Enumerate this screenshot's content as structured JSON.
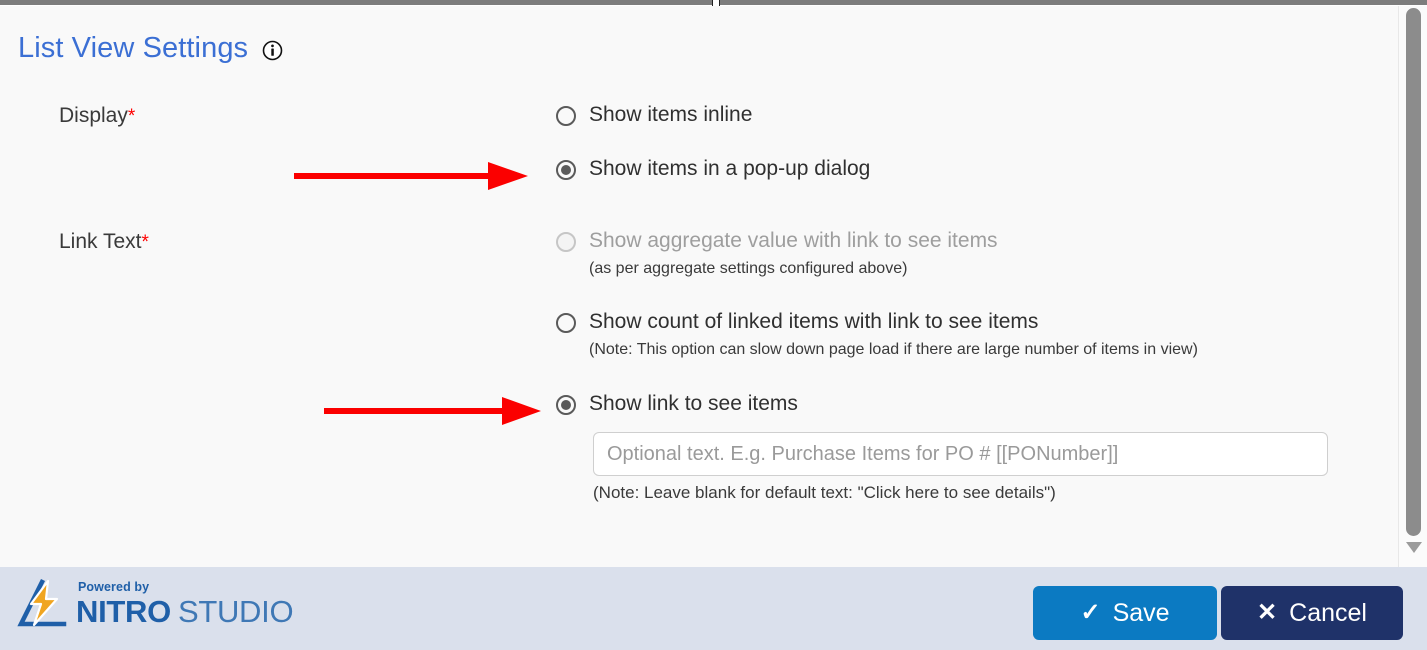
{
  "window": {
    "title": "List View Settings",
    "info_icon": "info-circle-icon"
  },
  "form": {
    "fields": [
      {
        "label": "Display",
        "required_marker": "*"
      },
      {
        "label": "Link Text",
        "required_marker": "*"
      }
    ],
    "display_options": [
      {
        "label": "Show items inline",
        "selected": false,
        "disabled": false,
        "note": ""
      },
      {
        "label": "Show items in a pop-up dialog",
        "selected": true,
        "disabled": false,
        "note": ""
      }
    ],
    "link_text_options": [
      {
        "label": "Show aggregate value with link to see items",
        "selected": false,
        "disabled": true,
        "note": "(as per aggregate settings configured above)"
      },
      {
        "label": "Show count of linked items with link to see items",
        "selected": false,
        "disabled": false,
        "note": "(Note: This option can slow down page load if there are large number of items in view)"
      },
      {
        "label": "Show link to see items",
        "selected": true,
        "disabled": false,
        "note": ""
      }
    ],
    "link_text_input": {
      "value": "",
      "placeholder": "Optional text. E.g. Purchase Items for PO # [[PONumber]]",
      "note": "(Note: Leave blank for default text: \"Click here to see details\")"
    }
  },
  "annotations": {
    "arrow_color": "#fb0000",
    "arrows": [
      {
        "name": "arrow-to-popup-option"
      },
      {
        "name": "arrow-to-show-link-option"
      }
    ]
  },
  "footer": {
    "logo": {
      "powered_by": "Powered by",
      "brand_primary": "NITRO",
      "brand_secondary": "STUDIO",
      "mark": "nitro-lightning-triangle-logo"
    },
    "save_label": "Save",
    "save_icon": "check-icon",
    "cancel_label": "Cancel",
    "cancel_icon": "close-x-icon",
    "save_color": "#0b7ac2",
    "cancel_color": "#1f3269",
    "background_color": "#dae0ec"
  },
  "scrollbar": {
    "vertical_thumb": "vertical-scrollbar-thumb",
    "down_arrow": "scroll-down-arrow"
  }
}
